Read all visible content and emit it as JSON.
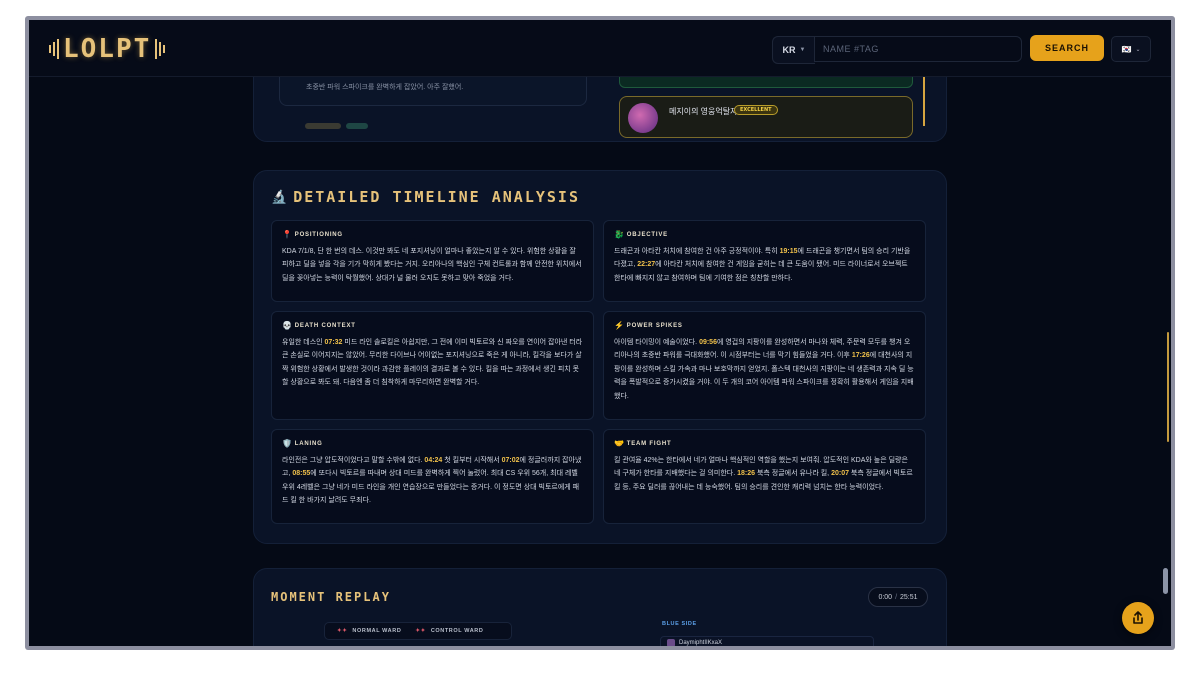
{
  "header": {
    "logo_text": "LOLPT",
    "region": "KR",
    "search_placeholder": "NAME #TAG",
    "search_label": "SEARCH",
    "lang_flag": "🇰🇷"
  },
  "previous_section": {
    "quote": "초중반 파워 스파이크를 완벽하게 잡았어. 아주 잘했어.",
    "achievement_title": "메지이의 영웅억탈자",
    "achievement_badge": "EXCELLENT"
  },
  "timeline": {
    "title": "DETAILED TIMELINE ANALYSIS",
    "title_icon": "🔬",
    "cells": [
      {
        "icon": "📍",
        "heading": "POSITIONING",
        "parts": [
          "KDA 7/1/8, 단 한 번의 데스. 이것만 봐도 네 포지셔닝이 얼마나 좋았는지 알 수 있다. 위험한 상황을 잘 피하고 딜을 넣을 각을 기가 막히게 봤다는 거지. 오리아나의 핵심인 구체 컨트롤과 함께 안전한 위치에서 딜을 꽂아넣는 능력이 탁월했어. 상대가 널 물러 오지도 못하고 맞아 죽었을 거다."
        ]
      },
      {
        "icon": "🐉",
        "heading": "OBJECTIVE",
        "parts": [
          "드래곤과 아타칸 처치에 참여한 건 아주 긍정적이야. 특히 ",
          "19:15",
          "에 드래곤을 챙기면서 팀의 승리 기반을 다졌고, ",
          "22:27",
          "에 아타칸 처치에 참여한 건 게임을 굳히는 데 큰 도움이 됐어. 미드 라이너로서 오브젝트 한타에 빠지지 않고 참여하며 팀에 기여한 점은 칭찬할 만하다."
        ]
      },
      {
        "icon": "💀",
        "heading": "DEATH CONTEXT",
        "parts": [
          "유일한 데스인 ",
          "07:32",
          " 미드 라인 솔로킬은 아쉽지만, 그 전에 이미 빅토르와 신 짜오를 연이어 잡아낸 터라 큰 손실로 이어지지는 않았어. 무리한 다이브나 어이없는 포지셔닝으로 죽은 게 아니라, 킬각을 보다가 살짝 위험한 상황에서 발생한 것이라 과감한 플레이의 결과로 볼 수 있다. 킬을 따는 과정에서 생긴 피치 못할 상황으로 봐도 돼. 다음엔 좀 더 침착하게 마무리하면 완벽할 거다."
        ]
      },
      {
        "icon": "⚡",
        "heading": "POWER SPIKES",
        "parts": [
          "아이템 타이밍이 예술이었다. ",
          "09:56",
          "에 영겁의 지팡이를 완성하면서 마나와 체력, 주문력 모두를 챙겨 오리아나의 초중반 파워를 극대화했어. 이 시점부터는 너를 막기 힘들었을 거다. 이후 ",
          "17:26",
          "에 대천사의 지팡이를 완성하며 스킬 가속과 마나 보호막까지 얻었지. 폴스텍 대천사의 지팡이는 네 생존력과 지속 딜 능력을 폭발적으로 증가시켰을 거야. 이 두 개의 코어 아이템 파워 스파이크를 정확히 활용해서 게임을 지배했다."
        ]
      },
      {
        "icon": "🛡️",
        "heading": "LANING",
        "parts": [
          "라인전은 그냥 압도적이었다고 말할 수밖에 없다. ",
          "04:24",
          " 첫 킬부터 시작해서 ",
          "07:02",
          "에 정글러까지 잡아냈고, ",
          "08:55",
          "에 또다시 빅토르를 따내며 상대 미드를 완벽하게 찍어 눌렀어. 최대 CS 우위 56개, 최대 레벨 우위 4레벨은 그냥 네가 미드 라인을 개인 연습장으로 만들었다는 증거다. 이 정도면 상대 빅토르에게 패드 킬 한 바가지 날려도 무죄다."
        ]
      },
      {
        "icon": "🤝",
        "heading": "TEAM FIGHT",
        "parts": [
          "킬 관여율 42%는 한타에서 네가 얼마나 핵심적인 역할을 했는지 보여줘. 압도적인 KDA와 높은 딜량은 네 구체가 한타를 지배했다는 걸 의미한다. ",
          "18:26",
          " 북측 정글에서 유나라 킬, ",
          "20:07",
          " 북측 정글에서 빅토르 킬 등, 주요 딜러를 끊어내는 데 능숙했어. 팀의 승리를 견인한 캐리력 넘치는 한타 능력이었다."
        ]
      }
    ]
  },
  "replay": {
    "title": "MOMENT REPLAY",
    "time_current": "0:00",
    "time_sep": "/",
    "time_total": "25:51",
    "legend_normal": "NORMAL WARD",
    "legend_control": "CONTROL WARD",
    "blue_side_label": "BLUE SIDE",
    "first_player": "DaymiphtIIKxaX"
  },
  "colors": {
    "accent": "#e6a21b",
    "gold_text": "#e6c27a",
    "highlight_time": "#f0c14b",
    "background": "#050a16"
  }
}
